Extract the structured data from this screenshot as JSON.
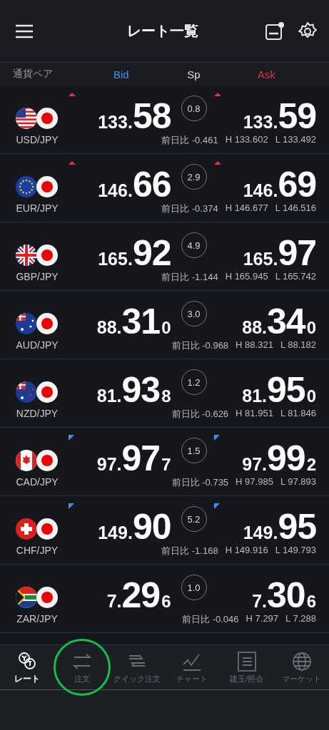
{
  "header": {
    "title": "レート一覧"
  },
  "columns": {
    "pair": "通貨ペア",
    "bid": "Bid",
    "spread": "Sp",
    "ask": "Ask"
  },
  "rates": [
    {
      "pair": "USD/JPY",
      "bid": {
        "head": "133.",
        "big": "58",
        "tick_up": true,
        "tick_down": false
      },
      "spread": "0.8",
      "ask": {
        "head": "133.",
        "big": "59",
        "tick_up": true,
        "tick_down": false
      },
      "change": "前日比 -0.461",
      "high": "H 133.602",
      "low": "L 133.492"
    },
    {
      "pair": "EUR/JPY",
      "bid": {
        "head": "146.",
        "big": "66",
        "tick_up": true,
        "tick_down": false
      },
      "spread": "2.9",
      "ask": {
        "head": "146.",
        "big": "69",
        "tick_up": true,
        "tick_down": false
      },
      "change": "前日比 -0.374",
      "high": "H 146.677",
      "low": "L 146.516"
    },
    {
      "pair": "GBP/JPY",
      "bid": {
        "head": "165.",
        "big": "92",
        "tick_up": false,
        "tick_down": false
      },
      "spread": "4.9",
      "ask": {
        "head": "165.",
        "big": "97",
        "tick_up": false,
        "tick_down": false
      },
      "change": "前日比 -1.144",
      "high": "H 165.945",
      "low": "L 165.742"
    },
    {
      "pair": "AUD/JPY",
      "bid": {
        "head": "88.",
        "big": "31",
        "tail": "0",
        "tick_up": false,
        "tick_down": false
      },
      "spread": "3.0",
      "ask": {
        "head": "88.",
        "big": "34",
        "tail": "0",
        "tick_up": false,
        "tick_down": false
      },
      "change": "前日比 -0.968",
      "high": "H 88.321",
      "low": "L 88.182"
    },
    {
      "pair": "NZD/JPY",
      "bid": {
        "head": "81.",
        "big": "93",
        "tail": "8",
        "tick_up": false,
        "tick_down": false
      },
      "spread": "1.2",
      "ask": {
        "head": "81.",
        "big": "95",
        "tail": "0",
        "tick_up": false,
        "tick_down": false
      },
      "change": "前日比 -0.626",
      "high": "H 81.951",
      "low": "L 81.846"
    },
    {
      "pair": "CAD/JPY",
      "bid": {
        "head": "97.",
        "big": "97",
        "tail": "7",
        "tick_up": false,
        "tick_down": true
      },
      "spread": "1.5",
      "ask": {
        "head": "97.",
        "big": "99",
        "tail": "2",
        "tick_up": false,
        "tick_down": true
      },
      "change": "前日比 -0.735",
      "high": "H 97.985",
      "low": "L 97.893"
    },
    {
      "pair": "CHF/JPY",
      "bid": {
        "head": "149.",
        "big": "90",
        "tick_up": false,
        "tick_down": true
      },
      "spread": "5.2",
      "ask": {
        "head": "149.",
        "big": "95",
        "tick_up": false,
        "tick_down": true
      },
      "change": "前日比 -1.168",
      "high": "H 149.916",
      "low": "L 149.793"
    },
    {
      "pair": "ZAR/JPY",
      "bid": {
        "head": "7.",
        "big": "29",
        "tail": "6",
        "tick_up": false,
        "tick_down": false
      },
      "spread": "1.0",
      "ask": {
        "head": "7.",
        "big": "30",
        "tail": "6",
        "tick_up": false,
        "tick_down": false
      },
      "change": "前日比 -0.046",
      "high": "H 7.297",
      "low": "L 7.288"
    }
  ],
  "nav": [
    {
      "label": "レート",
      "selected": true,
      "highlighted": false
    },
    {
      "label": "注文",
      "selected": false,
      "highlighted": true
    },
    {
      "label": "クイック注文",
      "selected": false,
      "highlighted": false
    },
    {
      "label": "チャート",
      "selected": false,
      "highlighted": false
    },
    {
      "label": "建玉/照会",
      "selected": false,
      "highlighted": false
    },
    {
      "label": "マーケット",
      "selected": false,
      "highlighted": false
    }
  ]
}
